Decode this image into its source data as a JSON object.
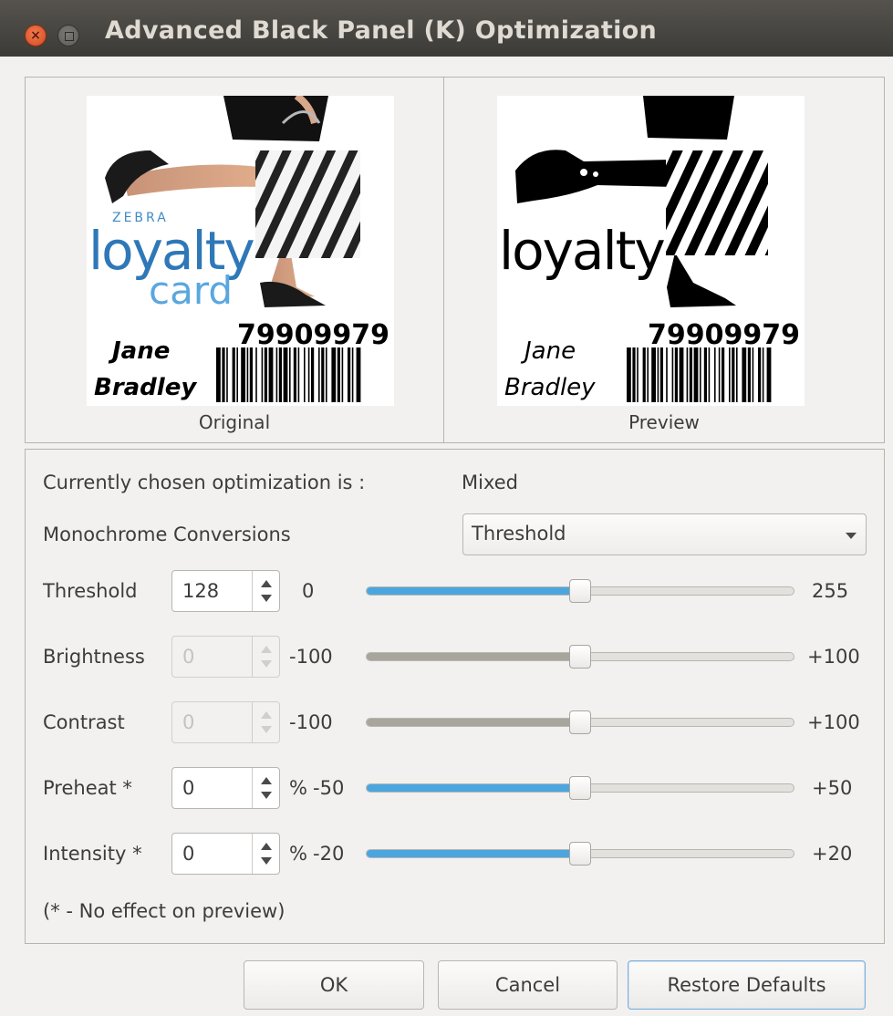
{
  "window": {
    "title": "Advanced Black Panel (K) Optimization",
    "close_glyph": "×"
  },
  "images": {
    "original_caption": "Original",
    "preview_caption": "Preview",
    "card": {
      "brand": "ZEBRA",
      "brand_line1": "loyalty",
      "brand_line2": "card",
      "number": "79909979",
      "name_first": "Jane",
      "name_last": "Bradley"
    }
  },
  "settings": {
    "current_label": "Currently chosen optimization is :",
    "current_value": "Mixed",
    "mono_label": "Monochrome Conversions",
    "mono_value": "Threshold",
    "footnote": "(* - No effect on preview)",
    "rows": [
      {
        "label": "Threshold",
        "value": "128",
        "unit": "",
        "min": "0",
        "max": "255",
        "enabled": true,
        "level": 0.5
      },
      {
        "label": "Brightness",
        "value": "0",
        "unit": "",
        "min": "-100",
        "max": "+100",
        "enabled": false,
        "level": 0.5
      },
      {
        "label": "Contrast",
        "value": "0",
        "unit": "",
        "min": "-100",
        "max": "+100",
        "enabled": false,
        "level": 0.5
      },
      {
        "label": "Preheat *",
        "value": "0",
        "unit": "%",
        "min": "-50",
        "max": "+50",
        "enabled": true,
        "level": 0.5
      },
      {
        "label": "Intensity *",
        "value": "0",
        "unit": "%",
        "min": "-20",
        "max": "+20",
        "enabled": true,
        "level": 0.5
      }
    ]
  },
  "buttons": {
    "ok": "OK",
    "cancel": "Cancel",
    "restore": "Restore Defaults"
  },
  "colors": {
    "accent": "#4ba6e0",
    "disabled_fill": "#a8a59d",
    "titlebar": "#3c3b37"
  }
}
